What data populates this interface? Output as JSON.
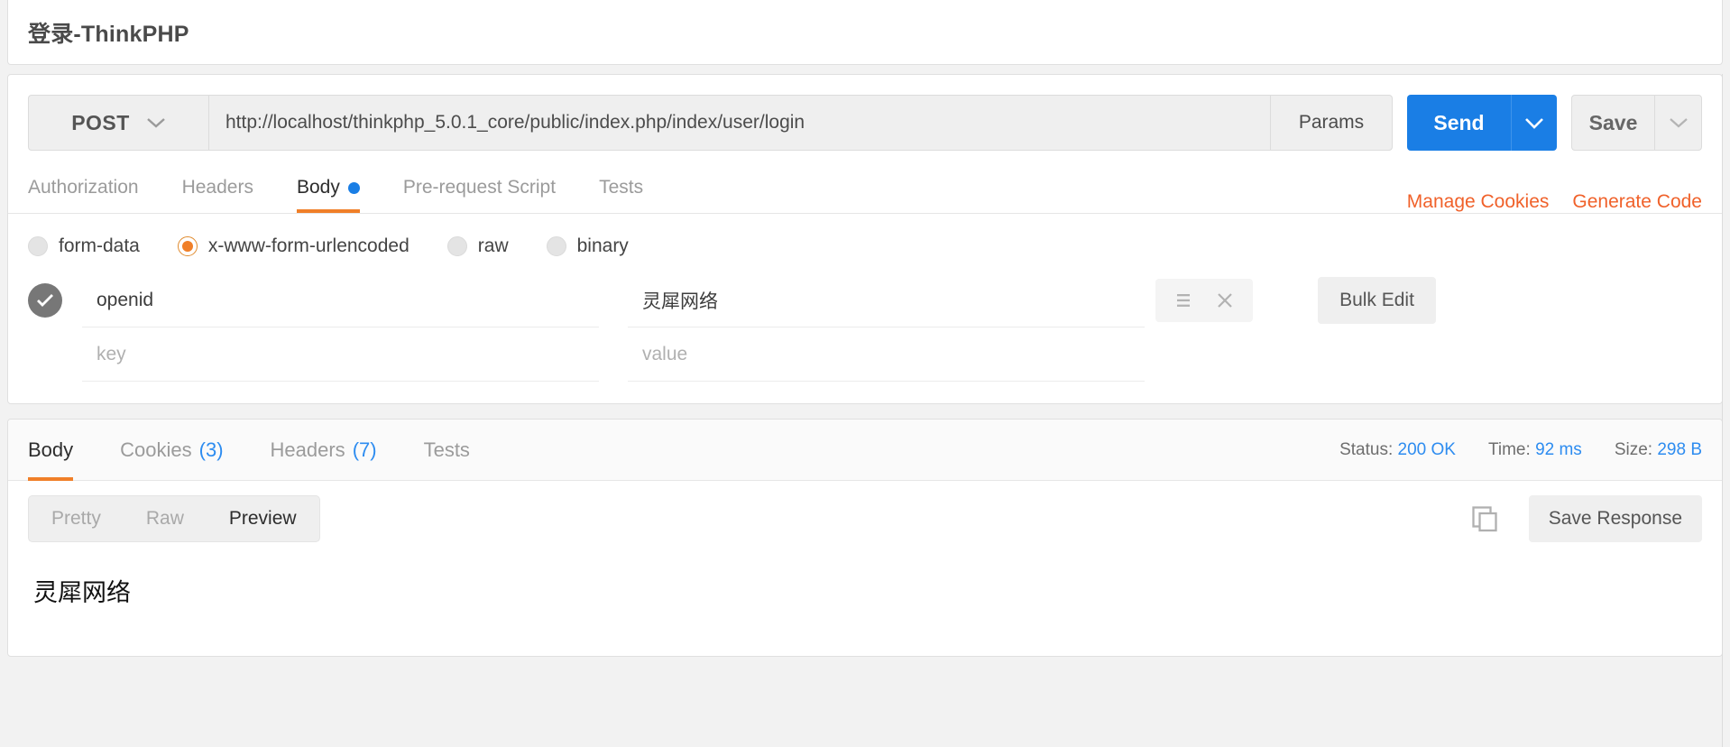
{
  "window": {
    "title": "登录-ThinkPHP"
  },
  "request": {
    "method": "POST",
    "method_caret_icon": "chevron-down-icon",
    "url": "http://localhost/thinkphp_5.0.1_core/public/index.php/index/user/login",
    "params_label": "Params",
    "send_label": "Send",
    "send_caret_icon": "chevron-down-icon",
    "save_label": "Save",
    "save_caret_icon": "chevron-down-icon",
    "accent_blue": "#1a7ee5",
    "accent_orange": "#f07f28",
    "tabs": [
      {
        "label": "Authorization",
        "active": false,
        "dot": false
      },
      {
        "label": "Headers",
        "active": false,
        "dot": false
      },
      {
        "label": "Body",
        "active": true,
        "dot": true
      },
      {
        "label": "Pre-request Script",
        "active": false,
        "dot": false
      },
      {
        "label": "Tests",
        "active": false,
        "dot": false
      }
    ],
    "links": [
      {
        "label": "Manage Cookies"
      },
      {
        "label": "Generate Code"
      }
    ],
    "body_types": [
      {
        "label": "form-data",
        "selected": false
      },
      {
        "label": "x-www-form-urlencoded",
        "selected": true
      },
      {
        "label": "raw",
        "selected": false
      },
      {
        "label": "binary",
        "selected": false
      }
    ],
    "kv_headers": {
      "key_placeholder": "key",
      "value_placeholder": "value"
    },
    "kv_rows": [
      {
        "checked": true,
        "key": "openid",
        "value": "灵犀网络"
      },
      {
        "checked": false,
        "key": "",
        "value": ""
      }
    ],
    "row_menu_icon": "list-menu-icon",
    "row_delete_icon": "close-icon",
    "bulk_edit_label": "Bulk Edit"
  },
  "response": {
    "tabs": [
      {
        "label": "Body",
        "count": "",
        "active": true
      },
      {
        "label": "Cookies",
        "count": "(3)",
        "active": false
      },
      {
        "label": "Headers",
        "count": "(7)",
        "active": false
      },
      {
        "label": "Tests",
        "count": "",
        "active": false
      }
    ],
    "meta": {
      "status_label": "Status:",
      "status_value": "200 OK",
      "time_label": "Time:",
      "time_value": "92 ms",
      "size_label": "Size:",
      "size_value": "298 B"
    },
    "view_modes": [
      {
        "label": "Pretty",
        "active": false
      },
      {
        "label": "Raw",
        "active": false
      },
      {
        "label": "Preview",
        "active": true
      }
    ],
    "copy_icon": "copy-icon",
    "save_response_label": "Save Response",
    "body_text": "灵犀网络"
  }
}
